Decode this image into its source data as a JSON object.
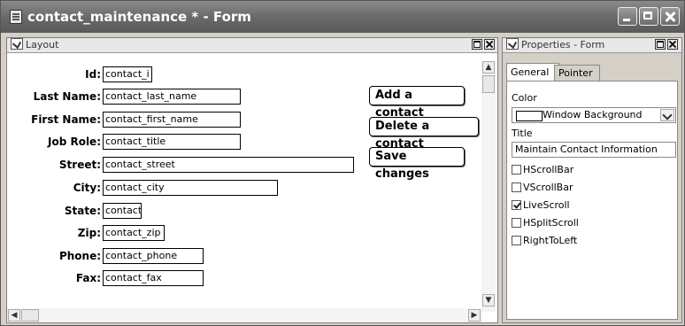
{
  "window": {
    "title": "contact_maintenance * - Form"
  },
  "layout": {
    "title": "Layout",
    "fields": [
      {
        "label": "Id:",
        "value": "contact_i"
      },
      {
        "label": "Last Name:",
        "value": "contact_last_name"
      },
      {
        "label": "First Name:",
        "value": "contact_first_name"
      },
      {
        "label": "Job Role:",
        "value": "contact_title"
      },
      {
        "label": "Street:",
        "value": "contact_street"
      },
      {
        "label": "City:",
        "value": "contact_city"
      },
      {
        "label": "State:",
        "value": "contact_"
      },
      {
        "label": "Zip:",
        "value": "contact_zip"
      },
      {
        "label": "Phone:",
        "value": "contact_phone"
      },
      {
        "label": "Fax:",
        "value": "contact_fax"
      }
    ],
    "buttons": {
      "add": "Add a contact",
      "delete": "Delete a contact",
      "save": "Save changes"
    }
  },
  "properties": {
    "title": "Properties - Form",
    "tabs": [
      "General",
      "Pointer"
    ],
    "color_label": "Color",
    "color_value": "Window Background",
    "title_label": "Title",
    "title_value": "Maintain Contact Information",
    "checkboxes": [
      {
        "label": "HScrollBar",
        "checked": false
      },
      {
        "label": "VScrollBar",
        "checked": false
      },
      {
        "label": "LiveScroll",
        "checked": true
      },
      {
        "label": "HSplitScroll",
        "checked": false
      },
      {
        "label": "RightToLeft",
        "checked": false
      }
    ]
  }
}
